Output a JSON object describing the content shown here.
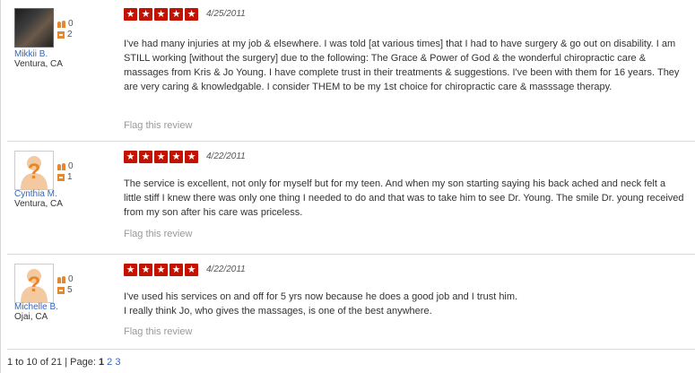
{
  "reviews": [
    {
      "avatar": "user-photo",
      "friends_count": "0",
      "reviews_count": "2",
      "name": "Mikkii B.",
      "location": "Ventura, CA",
      "rating": 5,
      "date": "4/25/2011",
      "text": "I've had many injuries at my job & elsewhere. I was told [at various times] that I had to have surgery & go out on disability. I am STILL working [without the surgery] due to the following: The Grace & Power of God & the wonderful chiropractic care & massages from Kris & Jo Young. I have complete trust in their treatments & suggestions. I've been with them for 16 years.  They are very caring & knowledgable. I consider THEM to be my 1st choice for chiropractic care & masssage therapy.",
      "flag": "Flag this review"
    },
    {
      "avatar": "default-avatar-icon",
      "friends_count": "0",
      "reviews_count": "1",
      "name": "Cynthia M.",
      "location": "Ventura, CA",
      "rating": 5,
      "date": "4/22/2011",
      "text": "The service is excellent, not only for myself but for my teen.  And when my son starting saying his back ached and neck felt a little stiff I knew there was only one thing I needed to do and that was to  take him to see Dr. Young.  The smile Dr. young received from my son after his care was priceless.",
      "flag": "Flag this review"
    },
    {
      "avatar": "default-avatar-icon",
      "friends_count": "0",
      "reviews_count": "5",
      "name": "Michelle B.",
      "location": "Ojai, CA",
      "rating": 5,
      "date": "4/22/2011",
      "text_lines": [
        "I've used his services on and off for 5 yrs now because he does a good job and I trust him.",
        "I really think Jo, who gives the massages, is one of the best anywhere."
      ],
      "flag": "Flag this review"
    }
  ],
  "pagination": {
    "summary": "1 to 10 of 21 | ",
    "page_label": "Page: ",
    "current": "1",
    "pages": [
      "2",
      "3"
    ]
  },
  "colors": {
    "star": "#c41200",
    "link": "#3366bb",
    "icon": "#e8862c"
  }
}
